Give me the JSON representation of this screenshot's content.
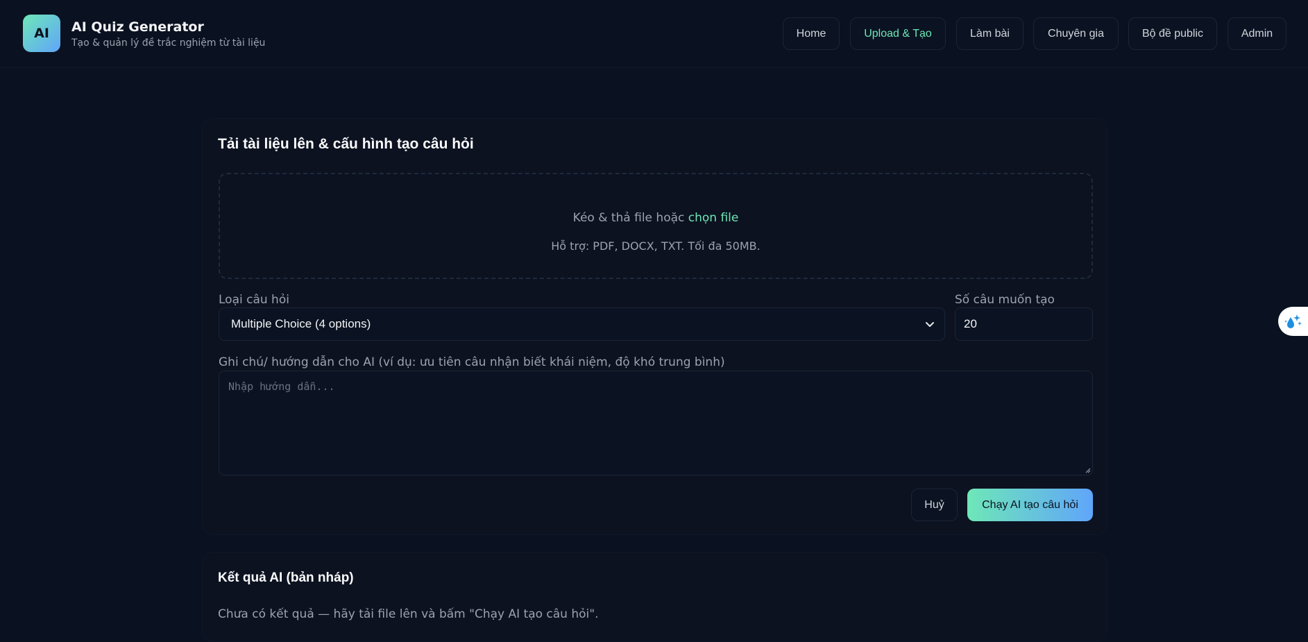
{
  "brand": {
    "logo_text": "AI",
    "title": "AI Quiz Generator",
    "subtitle": "Tạo & quản lý đề trắc nghiệm từ tài liệu"
  },
  "nav": {
    "items": [
      {
        "label": "Home",
        "active": false
      },
      {
        "label": "Upload & Tạo",
        "active": true
      },
      {
        "label": "Làm bài",
        "active": false
      },
      {
        "label": "Chuyên gia",
        "active": false
      },
      {
        "label": "Bộ đề public",
        "active": false
      },
      {
        "label": "Admin",
        "active": false
      }
    ]
  },
  "upload_card": {
    "title": "Tải tài liệu lên & cấu hình tạo câu hỏi",
    "dropzone": {
      "prompt": "Kéo & thả file hoặc ",
      "link": "chọn file",
      "support": "Hỗ trợ: PDF, DOCX, TXT. Tối đa 50MB."
    },
    "question_type": {
      "label": "Loại câu hỏi",
      "value": "Multiple Choice (4 options)"
    },
    "count": {
      "label": "Số câu muốn tạo",
      "value": "20"
    },
    "notes": {
      "label": "Ghi chú/ hướng dẫn cho AI (ví dụ: ưu tiên câu nhận biết khái niệm, độ khó trung bình)",
      "placeholder": "Nhập hướng dẫn..."
    },
    "cancel_label": "Huỷ",
    "run_label": "Chạy AI tạo câu hỏi"
  },
  "result_card": {
    "title": "Kết quả AI (bản nháp)",
    "empty_text": "Chưa có kết quả — hãy tải file lên và bấm \"Chạy AI tạo câu hỏi\"."
  },
  "colors": {
    "background": "#0a1120",
    "accent_green": "#6ee7b7",
    "accent_blue": "#60a5fa"
  }
}
